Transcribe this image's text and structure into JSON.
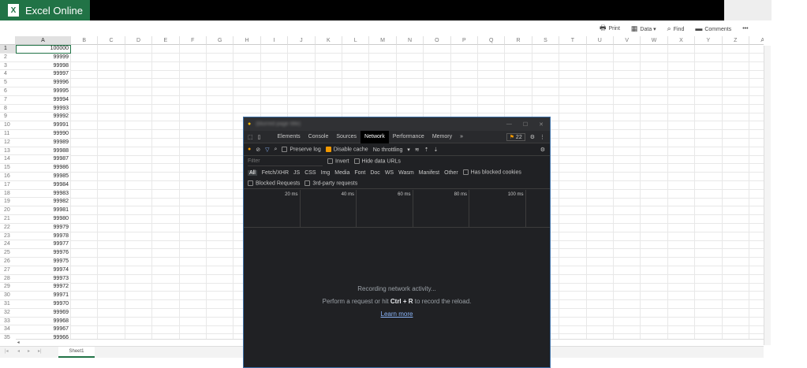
{
  "app": {
    "title": "Excel Online",
    "logo": "X"
  },
  "ribbon": [
    {
      "icon": "print-icon",
      "glyph": "🖶",
      "label": "Print"
    },
    {
      "icon": "data-icon",
      "glyph": "▦",
      "label": "Data ▾"
    },
    {
      "icon": "search-icon",
      "glyph": "⌕",
      "label": "Find"
    },
    {
      "icon": "comment-icon",
      "glyph": "▬",
      "label": "Comments"
    },
    {
      "icon": "more-icon",
      "glyph": "",
      "label": "•••"
    }
  ],
  "columns": [
    "A",
    "B",
    "C",
    "D",
    "E",
    "F",
    "G",
    "H",
    "I",
    "J",
    "K",
    "L",
    "M",
    "N",
    "O",
    "P",
    "Q",
    "R",
    "S",
    "T",
    "U",
    "V",
    "W",
    "X",
    "Y",
    "Z",
    "A"
  ],
  "rows": [
    "100000",
    "99999",
    "99998",
    "99997",
    "99996",
    "99995",
    "99994",
    "99993",
    "99992",
    "99991",
    "99990",
    "99989",
    "99988",
    "99987",
    "99986",
    "99985",
    "99984",
    "99983",
    "99982",
    "99981",
    "99980",
    "99979",
    "99978",
    "99977",
    "99976",
    "99975",
    "99974",
    "99973",
    "99972",
    "99971",
    "99970",
    "99969",
    "99968",
    "99967",
    "99966"
  ],
  "sheet_tab": "Sheet1",
  "accent": "#217346",
  "devtools": {
    "title": "(blurred page title)",
    "tabs": [
      "Elements",
      "Console",
      "Sources",
      "Network",
      "Performance",
      "Memory",
      "»"
    ],
    "active_tab": "Network",
    "issues_count": "22",
    "toolbar": {
      "preserve_log": "Preserve log",
      "disable_cache": "Disable cache",
      "throttling": "No throttling"
    },
    "filter_placeholder": "Filter",
    "invert": "Invert",
    "hide_data_urls": "Hide data URLs",
    "types": [
      "All",
      "Fetch/XHR",
      "JS",
      "CSS",
      "Img",
      "Media",
      "Font",
      "Doc",
      "WS",
      "Wasm",
      "Manifest",
      "Other"
    ],
    "has_blocked_cookies": "Has blocked cookies",
    "blocked_requests": "Blocked Requests",
    "third_party": "3rd-party requests",
    "ticks": [
      "20 ms",
      "40 ms",
      "60 ms",
      "80 ms",
      "100 ms"
    ],
    "empty": {
      "line1": "Recording network activity...",
      "line2a": "Perform a request or hit ",
      "line2b": "Ctrl + R",
      "line2c": " to record the reload.",
      "link": "Learn more"
    }
  }
}
